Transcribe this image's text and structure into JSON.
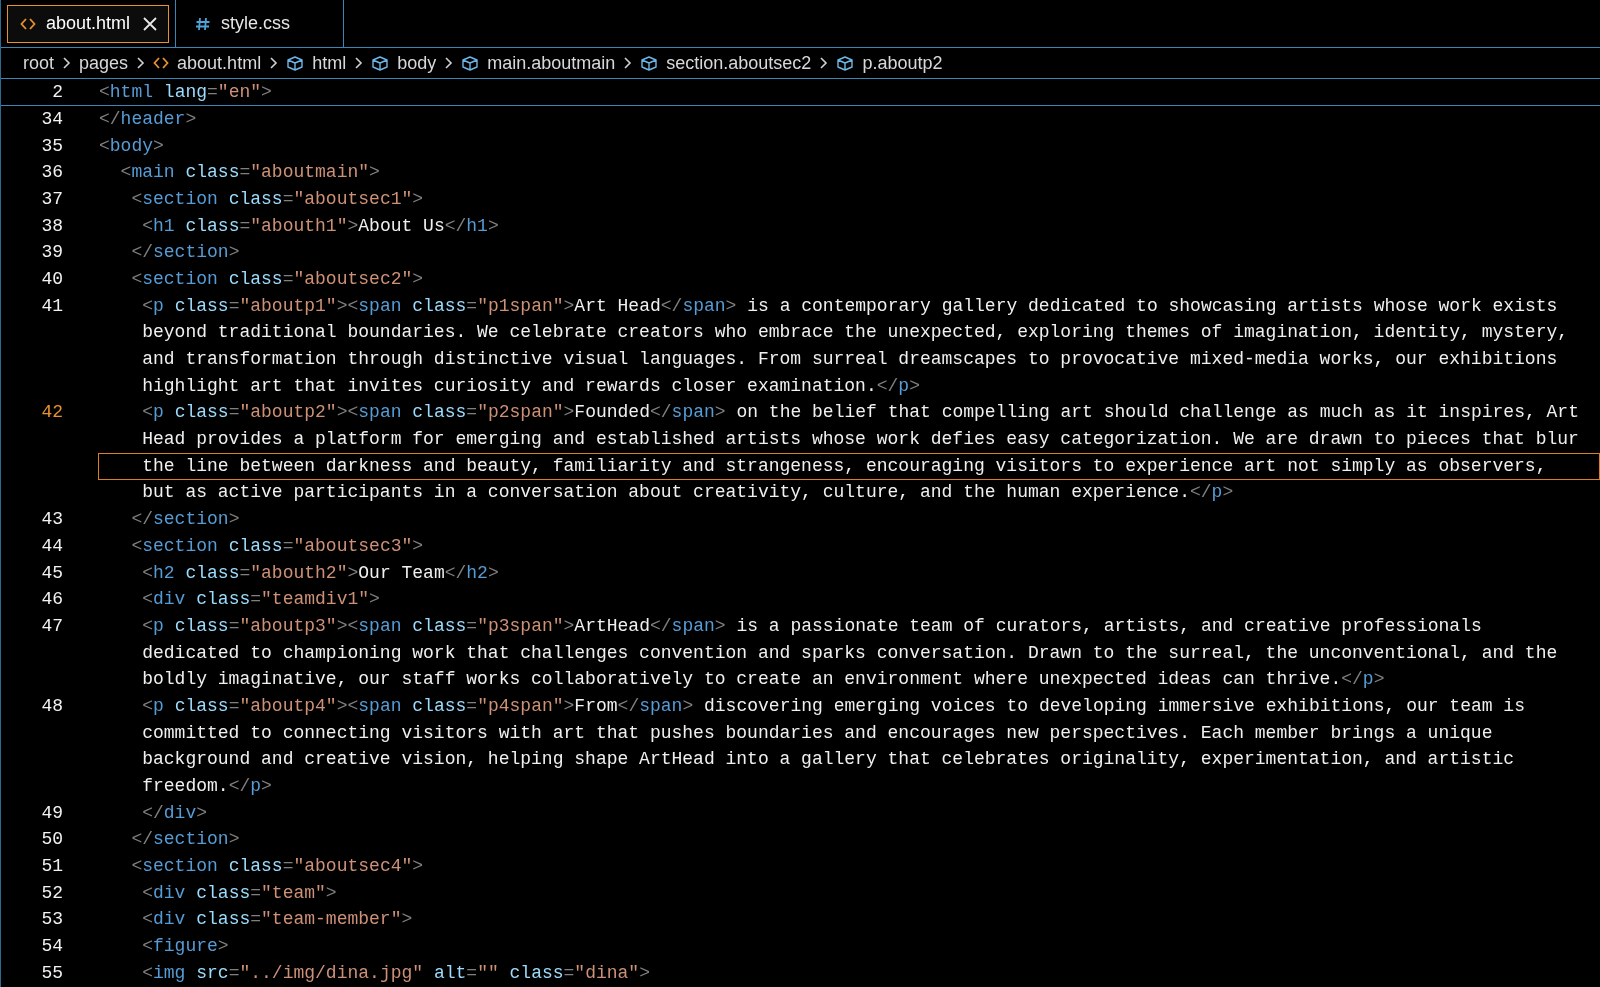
{
  "tabs": [
    {
      "label": "about.html",
      "kind": "html",
      "selected": true,
      "closable": true
    },
    {
      "label": "style.css",
      "kind": "css",
      "selected": false,
      "closable": false
    }
  ],
  "breadcrumb": [
    {
      "label": "root",
      "kind": "plain"
    },
    {
      "label": "pages",
      "kind": "plain"
    },
    {
      "label": "about.html",
      "kind": "html"
    },
    {
      "label": "html",
      "kind": "element"
    },
    {
      "label": "body",
      "kind": "element"
    },
    {
      "label": "main.aboutmain",
      "kind": "element"
    },
    {
      "label": "section.aboutsec2",
      "kind": "element"
    },
    {
      "label": "p.aboutp2",
      "kind": "element"
    }
  ],
  "sticky_line": {
    "number": "2",
    "tokens": [
      {
        "kind": "punct",
        "text": "<"
      },
      {
        "kind": "tag",
        "text": "html"
      },
      {
        "kind": "attr",
        "text": " lang"
      },
      {
        "kind": "punct",
        "text": "="
      },
      {
        "kind": "str",
        "text": "\"en\""
      },
      {
        "kind": "punct",
        "text": ">"
      }
    ]
  },
  "lines": [
    {
      "number": "34",
      "active": false,
      "rows": [
        {
          "highlighted": false,
          "tokens": [
            {
              "kind": "punct",
              "text": "</"
            },
            {
              "kind": "tag",
              "text": "header"
            },
            {
              "kind": "punct",
              "text": ">"
            }
          ]
        }
      ]
    },
    {
      "number": "35",
      "active": false,
      "rows": [
        {
          "highlighted": false,
          "tokens": [
            {
              "kind": "punct",
              "text": "<"
            },
            {
              "kind": "tag",
              "text": "body"
            },
            {
              "kind": "punct",
              "text": ">"
            }
          ]
        }
      ]
    },
    {
      "number": "36",
      "active": false,
      "rows": [
        {
          "highlighted": false,
          "tokens": [
            {
              "kind": "punct",
              "text": "  <"
            },
            {
              "kind": "tag",
              "text": "main"
            },
            {
              "kind": "attr",
              "text": " class"
            },
            {
              "kind": "punct",
              "text": "="
            },
            {
              "kind": "str",
              "text": "\"aboutmain\""
            },
            {
              "kind": "punct",
              "text": ">"
            }
          ]
        }
      ]
    },
    {
      "number": "37",
      "active": false,
      "rows": [
        {
          "highlighted": false,
          "tokens": [
            {
              "kind": "punct",
              "text": "   <"
            },
            {
              "kind": "tag",
              "text": "section"
            },
            {
              "kind": "attr",
              "text": " class"
            },
            {
              "kind": "punct",
              "text": "="
            },
            {
              "kind": "str",
              "text": "\"aboutsec1\""
            },
            {
              "kind": "punct",
              "text": ">"
            }
          ]
        }
      ]
    },
    {
      "number": "38",
      "active": false,
      "rows": [
        {
          "highlighted": false,
          "tokens": [
            {
              "kind": "punct",
              "text": "    <"
            },
            {
              "kind": "tag",
              "text": "h1"
            },
            {
              "kind": "attr",
              "text": " class"
            },
            {
              "kind": "punct",
              "text": "="
            },
            {
              "kind": "str",
              "text": "\"abouth1\""
            },
            {
              "kind": "punct",
              "text": ">"
            },
            {
              "kind": "text",
              "text": "About Us"
            },
            {
              "kind": "punct",
              "text": "</"
            },
            {
              "kind": "tag",
              "text": "h1"
            },
            {
              "kind": "punct",
              "text": ">"
            }
          ]
        }
      ]
    },
    {
      "number": "39",
      "active": false,
      "rows": [
        {
          "highlighted": false,
          "tokens": [
            {
              "kind": "punct",
              "text": "   </"
            },
            {
              "kind": "tag",
              "text": "section"
            },
            {
              "kind": "punct",
              "text": ">"
            }
          ]
        }
      ]
    },
    {
      "number": "40",
      "active": false,
      "rows": [
        {
          "highlighted": false,
          "tokens": [
            {
              "kind": "punct",
              "text": "   <"
            },
            {
              "kind": "tag",
              "text": "section"
            },
            {
              "kind": "attr",
              "text": " class"
            },
            {
              "kind": "punct",
              "text": "="
            },
            {
              "kind": "str",
              "text": "\"aboutsec2\""
            },
            {
              "kind": "punct",
              "text": ">"
            }
          ]
        }
      ]
    },
    {
      "number": "41",
      "active": false,
      "rows": [
        {
          "highlighted": false,
          "tokens": [
            {
              "kind": "punct",
              "text": "    <"
            },
            {
              "kind": "tag",
              "text": "p"
            },
            {
              "kind": "attr",
              "text": " class"
            },
            {
              "kind": "punct",
              "text": "="
            },
            {
              "kind": "str",
              "text": "\"aboutp1\""
            },
            {
              "kind": "punct",
              "text": "><"
            },
            {
              "kind": "tag",
              "text": "span"
            },
            {
              "kind": "attr",
              "text": " class"
            },
            {
              "kind": "punct",
              "text": "="
            },
            {
              "kind": "str",
              "text": "\"p1span\""
            },
            {
              "kind": "punct",
              "text": ">"
            },
            {
              "kind": "text",
              "text": "Art Head"
            },
            {
              "kind": "punct",
              "text": "</"
            },
            {
              "kind": "tag",
              "text": "span"
            },
            {
              "kind": "punct",
              "text": ">"
            },
            {
              "kind": "text",
              "text": " is a contemporary gallery dedicated to showcasing artists whose work exists"
            }
          ]
        },
        {
          "highlighted": false,
          "tokens": [
            {
              "kind": "text",
              "text": "    beyond traditional boundaries. We celebrate creators who embrace the unexpected, exploring themes of imagination, identity, mystery,"
            }
          ]
        },
        {
          "highlighted": false,
          "tokens": [
            {
              "kind": "text",
              "text": "    and transformation through distinctive visual languages. From surreal dreamscapes to provocative mixed-media works, our exhibitions"
            }
          ]
        },
        {
          "highlighted": false,
          "tokens": [
            {
              "kind": "text",
              "text": "    highlight art that invites curiosity and rewards closer examination."
            },
            {
              "kind": "punct",
              "text": "</"
            },
            {
              "kind": "tag",
              "text": "p"
            },
            {
              "kind": "punct",
              "text": ">"
            }
          ]
        }
      ]
    },
    {
      "number": "42",
      "active": true,
      "rows": [
        {
          "highlighted": false,
          "tokens": [
            {
              "kind": "punct",
              "text": "    <"
            },
            {
              "kind": "tag",
              "text": "p"
            },
            {
              "kind": "attr",
              "text": " class"
            },
            {
              "kind": "punct",
              "text": "="
            },
            {
              "kind": "str",
              "text": "\"aboutp2\""
            },
            {
              "kind": "punct",
              "text": "><"
            },
            {
              "kind": "tag",
              "text": "span"
            },
            {
              "kind": "attr",
              "text": " class"
            },
            {
              "kind": "punct",
              "text": "="
            },
            {
              "kind": "str",
              "text": "\"p2span\""
            },
            {
              "kind": "punct",
              "text": ">"
            },
            {
              "kind": "text",
              "text": "Founded"
            },
            {
              "kind": "punct",
              "text": "</"
            },
            {
              "kind": "tag",
              "text": "span"
            },
            {
              "kind": "punct",
              "text": ">"
            },
            {
              "kind": "text",
              "text": " on the belief that compelling art should challenge as much as it inspires, Art"
            }
          ]
        },
        {
          "highlighted": false,
          "tokens": [
            {
              "kind": "text",
              "text": "    Head provides a platform for emerging and established artists whose work defies easy categorization. We are drawn to pieces that blur"
            }
          ]
        },
        {
          "highlighted": true,
          "tokens": [
            {
              "kind": "text",
              "text": "    the line between darkness and beauty, familiarity and strangeness, encouraging visitors to experience art not simply as observers,"
            }
          ]
        },
        {
          "highlighted": false,
          "tokens": [
            {
              "kind": "text",
              "text": "    but as active participants in a conversation about creativity, culture, and the human experience."
            },
            {
              "kind": "punct",
              "text": "</"
            },
            {
              "kind": "tag",
              "text": "p"
            },
            {
              "kind": "punct",
              "text": ">"
            }
          ]
        }
      ]
    },
    {
      "number": "43",
      "active": false,
      "rows": [
        {
          "highlighted": false,
          "tokens": [
            {
              "kind": "punct",
              "text": "   </"
            },
            {
              "kind": "tag",
              "text": "section"
            },
            {
              "kind": "punct",
              "text": ">"
            }
          ]
        }
      ]
    },
    {
      "number": "44",
      "active": false,
      "rows": [
        {
          "highlighted": false,
          "tokens": [
            {
              "kind": "punct",
              "text": "   <"
            },
            {
              "kind": "tag",
              "text": "section"
            },
            {
              "kind": "attr",
              "text": " class"
            },
            {
              "kind": "punct",
              "text": "="
            },
            {
              "kind": "str",
              "text": "\"aboutsec3\""
            },
            {
              "kind": "punct",
              "text": ">"
            }
          ]
        }
      ]
    },
    {
      "number": "45",
      "active": false,
      "rows": [
        {
          "highlighted": false,
          "tokens": [
            {
              "kind": "punct",
              "text": "    <"
            },
            {
              "kind": "tag",
              "text": "h2"
            },
            {
              "kind": "attr",
              "text": " class"
            },
            {
              "kind": "punct",
              "text": "="
            },
            {
              "kind": "str",
              "text": "\"abouth2\""
            },
            {
              "kind": "punct",
              "text": ">"
            },
            {
              "kind": "text",
              "text": "Our Team"
            },
            {
              "kind": "punct",
              "text": "</"
            },
            {
              "kind": "tag",
              "text": "h2"
            },
            {
              "kind": "punct",
              "text": ">"
            }
          ]
        }
      ]
    },
    {
      "number": "46",
      "active": false,
      "rows": [
        {
          "highlighted": false,
          "tokens": [
            {
              "kind": "punct",
              "text": "    <"
            },
            {
              "kind": "tag",
              "text": "div"
            },
            {
              "kind": "attr",
              "text": " class"
            },
            {
              "kind": "punct",
              "text": "="
            },
            {
              "kind": "str",
              "text": "\"teamdiv1\""
            },
            {
              "kind": "punct",
              "text": ">"
            }
          ]
        }
      ]
    },
    {
      "number": "47",
      "active": false,
      "rows": [
        {
          "highlighted": false,
          "tokens": [
            {
              "kind": "punct",
              "text": "    <"
            },
            {
              "kind": "tag",
              "text": "p"
            },
            {
              "kind": "attr",
              "text": " class"
            },
            {
              "kind": "punct",
              "text": "="
            },
            {
              "kind": "str",
              "text": "\"aboutp3\""
            },
            {
              "kind": "punct",
              "text": "><"
            },
            {
              "kind": "tag",
              "text": "span"
            },
            {
              "kind": "attr",
              "text": " class"
            },
            {
              "kind": "punct",
              "text": "="
            },
            {
              "kind": "str",
              "text": "\"p3span\""
            },
            {
              "kind": "punct",
              "text": ">"
            },
            {
              "kind": "text",
              "text": "ArtHead"
            },
            {
              "kind": "punct",
              "text": "</"
            },
            {
              "kind": "tag",
              "text": "span"
            },
            {
              "kind": "punct",
              "text": ">"
            },
            {
              "kind": "text",
              "text": " is a passionate team of curators, artists, and creative professionals"
            }
          ]
        },
        {
          "highlighted": false,
          "tokens": [
            {
              "kind": "text",
              "text": "    dedicated to championing work that challenges convention and sparks conversation. Drawn to the surreal, the unconventional, and the"
            }
          ]
        },
        {
          "highlighted": false,
          "tokens": [
            {
              "kind": "text",
              "text": "    boldly imaginative, our staff works collaboratively to create an environment where unexpected ideas can thrive."
            },
            {
              "kind": "punct",
              "text": "</"
            },
            {
              "kind": "tag",
              "text": "p"
            },
            {
              "kind": "punct",
              "text": ">"
            }
          ]
        }
      ]
    },
    {
      "number": "48",
      "active": false,
      "rows": [
        {
          "highlighted": false,
          "tokens": [
            {
              "kind": "punct",
              "text": "    <"
            },
            {
              "kind": "tag",
              "text": "p"
            },
            {
              "kind": "attr",
              "text": " class"
            },
            {
              "kind": "punct",
              "text": "="
            },
            {
              "kind": "str",
              "text": "\"aboutp4\""
            },
            {
              "kind": "punct",
              "text": "><"
            },
            {
              "kind": "tag",
              "text": "span"
            },
            {
              "kind": "attr",
              "text": " class"
            },
            {
              "kind": "punct",
              "text": "="
            },
            {
              "kind": "str",
              "text": "\"p4span\""
            },
            {
              "kind": "punct",
              "text": ">"
            },
            {
              "kind": "text",
              "text": "From"
            },
            {
              "kind": "punct",
              "text": "</"
            },
            {
              "kind": "tag",
              "text": "span"
            },
            {
              "kind": "punct",
              "text": ">"
            },
            {
              "kind": "text",
              "text": " discovering emerging voices to developing immersive exhibitions, our team is"
            }
          ]
        },
        {
          "highlighted": false,
          "tokens": [
            {
              "kind": "text",
              "text": "    committed to connecting visitors with art that pushes boundaries and encourages new perspectives. Each member brings a unique"
            }
          ]
        },
        {
          "highlighted": false,
          "tokens": [
            {
              "kind": "text",
              "text": "    background and creative vision, helping shape ArtHead into a gallery that celebrates originality, experimentation, and artistic"
            }
          ]
        },
        {
          "highlighted": false,
          "tokens": [
            {
              "kind": "text",
              "text": "    freedom."
            },
            {
              "kind": "punct",
              "text": "</"
            },
            {
              "kind": "tag",
              "text": "p"
            },
            {
              "kind": "punct",
              "text": ">"
            }
          ]
        }
      ]
    },
    {
      "number": "49",
      "active": false,
      "rows": [
        {
          "highlighted": false,
          "tokens": [
            {
              "kind": "punct",
              "text": "    </"
            },
            {
              "kind": "tag",
              "text": "div"
            },
            {
              "kind": "punct",
              "text": ">"
            }
          ]
        }
      ]
    },
    {
      "number": "50",
      "active": false,
      "rows": [
        {
          "highlighted": false,
          "tokens": [
            {
              "kind": "punct",
              "text": "   </"
            },
            {
              "kind": "tag",
              "text": "section"
            },
            {
              "kind": "punct",
              "text": ">"
            }
          ]
        }
      ]
    },
    {
      "number": "51",
      "active": false,
      "rows": [
        {
          "highlighted": false,
          "tokens": [
            {
              "kind": "punct",
              "text": "   <"
            },
            {
              "kind": "tag",
              "text": "section"
            },
            {
              "kind": "attr",
              "text": " class"
            },
            {
              "kind": "punct",
              "text": "="
            },
            {
              "kind": "str",
              "text": "\"aboutsec4\""
            },
            {
              "kind": "punct",
              "text": ">"
            }
          ]
        }
      ]
    },
    {
      "number": "52",
      "active": false,
      "rows": [
        {
          "highlighted": false,
          "tokens": [
            {
              "kind": "punct",
              "text": "    <"
            },
            {
              "kind": "tag",
              "text": "div"
            },
            {
              "kind": "attr",
              "text": " class"
            },
            {
              "kind": "punct",
              "text": "="
            },
            {
              "kind": "str",
              "text": "\"team\""
            },
            {
              "kind": "punct",
              "text": ">"
            }
          ]
        }
      ]
    },
    {
      "number": "53",
      "active": false,
      "rows": [
        {
          "highlighted": false,
          "tokens": [
            {
              "kind": "punct",
              "text": "    <"
            },
            {
              "kind": "tag",
              "text": "div"
            },
            {
              "kind": "attr",
              "text": " class"
            },
            {
              "kind": "punct",
              "text": "="
            },
            {
              "kind": "str",
              "text": "\"team-member\""
            },
            {
              "kind": "punct",
              "text": ">"
            }
          ]
        }
      ]
    },
    {
      "number": "54",
      "active": false,
      "rows": [
        {
          "highlighted": false,
          "tokens": [
            {
              "kind": "punct",
              "text": "    <"
            },
            {
              "kind": "tag",
              "text": "figure"
            },
            {
              "kind": "punct",
              "text": ">"
            }
          ]
        }
      ]
    },
    {
      "number": "55",
      "active": false,
      "rows": [
        {
          "highlighted": false,
          "tokens": [
            {
              "kind": "punct",
              "text": "    <"
            },
            {
              "kind": "tag",
              "text": "img"
            },
            {
              "kind": "attr",
              "text": " src"
            },
            {
              "kind": "punct",
              "text": "="
            },
            {
              "kind": "str",
              "text": "\"../img/dina.jpg\""
            },
            {
              "kind": "attr",
              "text": " alt"
            },
            {
              "kind": "punct",
              "text": "="
            },
            {
              "kind": "str",
              "text": "\"\""
            },
            {
              "kind": "attr",
              "text": " class"
            },
            {
              "kind": "punct",
              "text": "="
            },
            {
              "kind": "str",
              "text": "\"dina\""
            },
            {
              "kind": "punct",
              "text": ">"
            }
          ]
        }
      ]
    }
  ]
}
